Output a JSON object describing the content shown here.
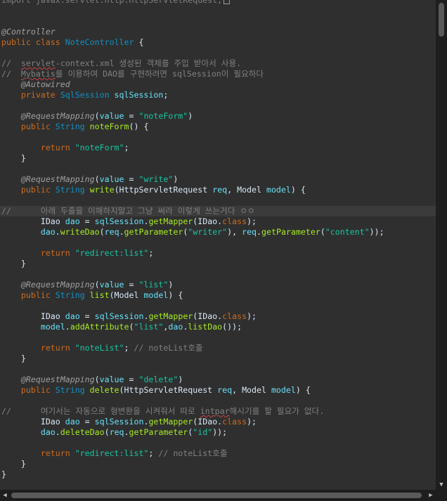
{
  "editor": {
    "lines": [
      [
        {
          "t": "import javax.servlet.http.HttpServletRequest;",
          "c": "cmt"
        },
        {
          "t": "",
          "c": "box"
        }
      ],
      [],
      [],
      [
        {
          "t": "@Controller",
          "c": "ann"
        }
      ],
      [
        {
          "t": "public ",
          "c": "kw"
        },
        {
          "t": "class ",
          "c": "kw"
        },
        {
          "t": "NoteController",
          "c": "typ"
        },
        {
          "t": " {",
          "c": ""
        }
      ],
      [],
      [
        {
          "t": "//  ",
          "c": "cmt"
        },
        {
          "t": "servlet",
          "c": "cmt squig"
        },
        {
          "t": "-context.xml 생성된 객체를 주입 받아서 사용.",
          "c": "cmt"
        }
      ],
      [
        {
          "t": "//  ",
          "c": "cmt"
        },
        {
          "t": "Mybatis",
          "c": "cmt squig"
        },
        {
          "t": "를 이용하여 DAO를 구현하려면 sqlSession이 필요하다",
          "c": "cmt"
        }
      ],
      [
        {
          "t": "    @Autowired",
          "c": "ann"
        }
      ],
      [
        {
          "t": "    private ",
          "c": "kw"
        },
        {
          "t": "SqlSession ",
          "c": "typ"
        },
        {
          "t": "sqlSession",
          "c": "var"
        },
        {
          "t": ";",
          "c": ""
        }
      ],
      [],
      [
        {
          "t": "    @RequestMapping",
          "c": "ann"
        },
        {
          "t": "(",
          "c": ""
        },
        {
          "t": "value",
          "c": "var"
        },
        {
          "t": " = ",
          "c": ""
        },
        {
          "t": "\"noteForm\"",
          "c": "str"
        },
        {
          "t": ")",
          "c": ""
        }
      ],
      [
        {
          "t": "    public ",
          "c": "kw"
        },
        {
          "t": "String ",
          "c": "typ"
        },
        {
          "t": "noteForm",
          "c": "mth"
        },
        {
          "t": "() {",
          "c": ""
        }
      ],
      [],
      [
        {
          "t": "        return ",
          "c": "kw"
        },
        {
          "t": "\"noteForm\"",
          "c": "str"
        },
        {
          "t": ";",
          "c": ""
        }
      ],
      [
        {
          "t": "    }",
          "c": ""
        }
      ],
      [],
      [
        {
          "t": "    @RequestMapping",
          "c": "ann"
        },
        {
          "t": "(",
          "c": ""
        },
        {
          "t": "value",
          "c": "var"
        },
        {
          "t": " = ",
          "c": ""
        },
        {
          "t": "\"write\"",
          "c": "str"
        },
        {
          "t": ")",
          "c": ""
        }
      ],
      [
        {
          "t": "    public ",
          "c": "kw"
        },
        {
          "t": "String ",
          "c": "typ"
        },
        {
          "t": "write",
          "c": "mth"
        },
        {
          "t": "(HttpServletRequest ",
          "c": ""
        },
        {
          "t": "req",
          "c": "var"
        },
        {
          "t": ", Model ",
          "c": ""
        },
        {
          "t": "model",
          "c": "var"
        },
        {
          "t": ") {",
          "c": ""
        }
      ],
      [],
      [
        {
          "t": "//      아래 두줄을 이해하지말고 그냥 써라 이렇게 쓰는거다 ㅇㅇ",
          "c": "cmt"
        }
      ],
      [
        {
          "t": "        IDao ",
          "c": ""
        },
        {
          "t": "dao",
          "c": "var"
        },
        {
          "t": " = ",
          "c": ""
        },
        {
          "t": "sqlSession",
          "c": "var"
        },
        {
          "t": ".",
          "c": ""
        },
        {
          "t": "getMapper",
          "c": "mth"
        },
        {
          "t": "(IDao.",
          "c": ""
        },
        {
          "t": "class",
          "c": "kw"
        },
        {
          "t": ");",
          "c": ""
        }
      ],
      [
        {
          "t": "        ",
          "c": ""
        },
        {
          "t": "dao",
          "c": "var"
        },
        {
          "t": ".",
          "c": ""
        },
        {
          "t": "writeDao",
          "c": "mth"
        },
        {
          "t": "(",
          "c": ""
        },
        {
          "t": "req",
          "c": "var"
        },
        {
          "t": ".",
          "c": ""
        },
        {
          "t": "getParameter",
          "c": "mth"
        },
        {
          "t": "(",
          "c": ""
        },
        {
          "t": "\"writer\"",
          "c": "str"
        },
        {
          "t": "), ",
          "c": ""
        },
        {
          "t": "req",
          "c": "var"
        },
        {
          "t": ".",
          "c": ""
        },
        {
          "t": "getParameter",
          "c": "mth"
        },
        {
          "t": "(",
          "c": ""
        },
        {
          "t": "\"content\"",
          "c": "str"
        },
        {
          "t": "));",
          "c": ""
        }
      ],
      [],
      [
        {
          "t": "        return ",
          "c": "kw"
        },
        {
          "t": "\"redirect:list\"",
          "c": "str"
        },
        {
          "t": ";",
          "c": ""
        }
      ],
      [
        {
          "t": "    }",
          "c": ""
        }
      ],
      [],
      [
        {
          "t": "    @RequestMapping",
          "c": "ann"
        },
        {
          "t": "(",
          "c": ""
        },
        {
          "t": "value",
          "c": "var"
        },
        {
          "t": " = ",
          "c": ""
        },
        {
          "t": "\"list\"",
          "c": "str"
        },
        {
          "t": ")",
          "c": ""
        }
      ],
      [
        {
          "t": "    public ",
          "c": "kw"
        },
        {
          "t": "String ",
          "c": "typ"
        },
        {
          "t": "list",
          "c": "mth"
        },
        {
          "t": "(Model ",
          "c": ""
        },
        {
          "t": "model",
          "c": "var"
        },
        {
          "t": ") {",
          "c": ""
        }
      ],
      [],
      [
        {
          "t": "        IDao ",
          "c": ""
        },
        {
          "t": "dao",
          "c": "var"
        },
        {
          "t": " = ",
          "c": ""
        },
        {
          "t": "sqlSession",
          "c": "var"
        },
        {
          "t": ".",
          "c": ""
        },
        {
          "t": "getMapper",
          "c": "mth"
        },
        {
          "t": "(IDao.",
          "c": ""
        },
        {
          "t": "class",
          "c": "kw"
        },
        {
          "t": ");",
          "c": ""
        }
      ],
      [
        {
          "t": "        ",
          "c": ""
        },
        {
          "t": "model",
          "c": "var"
        },
        {
          "t": ".",
          "c": ""
        },
        {
          "t": "addAttribute",
          "c": "mth"
        },
        {
          "t": "(",
          "c": ""
        },
        {
          "t": "\"list\"",
          "c": "str"
        },
        {
          "t": ",",
          "c": ""
        },
        {
          "t": "dao",
          "c": "var"
        },
        {
          "t": ".",
          "c": ""
        },
        {
          "t": "listDao",
          "c": "mth"
        },
        {
          "t": "());",
          "c": ""
        }
      ],
      [],
      [
        {
          "t": "        return ",
          "c": "kw"
        },
        {
          "t": "\"noteList\"",
          "c": "str"
        },
        {
          "t": "; ",
          "c": ""
        },
        {
          "t": "// noteList호출",
          "c": "cmt"
        }
      ],
      [
        {
          "t": "    }",
          "c": ""
        }
      ],
      [],
      [
        {
          "t": "    @RequestMapping",
          "c": "ann"
        },
        {
          "t": "(",
          "c": ""
        },
        {
          "t": "value",
          "c": "var"
        },
        {
          "t": " = ",
          "c": ""
        },
        {
          "t": "\"delete\"",
          "c": "str"
        },
        {
          "t": ")",
          "c": ""
        }
      ],
      [
        {
          "t": "    public ",
          "c": "kw"
        },
        {
          "t": "String ",
          "c": "typ"
        },
        {
          "t": "delete",
          "c": "mth"
        },
        {
          "t": "(HttpServletRequest ",
          "c": ""
        },
        {
          "t": "req",
          "c": "var"
        },
        {
          "t": ", Model ",
          "c": ""
        },
        {
          "t": "model",
          "c": "var"
        },
        {
          "t": ") {",
          "c": ""
        }
      ],
      [],
      [
        {
          "t": "//      여기서는 자동으로 형변환을 시켜줘서 따로 ",
          "c": "cmt"
        },
        {
          "t": "intpar",
          "c": "cmt squig"
        },
        {
          "t": "해시기를 할 필요가 없다.",
          "c": "cmt"
        }
      ],
      [
        {
          "t": "        IDao ",
          "c": ""
        },
        {
          "t": "dao",
          "c": "var"
        },
        {
          "t": " = ",
          "c": ""
        },
        {
          "t": "sqlSession",
          "c": "var"
        },
        {
          "t": ".",
          "c": ""
        },
        {
          "t": "getMapper",
          "c": "mth"
        },
        {
          "t": "(IDao.",
          "c": ""
        },
        {
          "t": "class",
          "c": "kw"
        },
        {
          "t": ");",
          "c": ""
        }
      ],
      [
        {
          "t": "        ",
          "c": ""
        },
        {
          "t": "dao",
          "c": "var"
        },
        {
          "t": ".",
          "c": ""
        },
        {
          "t": "deleteDao",
          "c": "mth"
        },
        {
          "t": "(",
          "c": ""
        },
        {
          "t": "req",
          "c": "var"
        },
        {
          "t": ".",
          "c": ""
        },
        {
          "t": "getParameter",
          "c": "mth"
        },
        {
          "t": "(",
          "c": ""
        },
        {
          "t": "\"id\"",
          "c": "str"
        },
        {
          "t": "));",
          "c": ""
        }
      ],
      [],
      [
        {
          "t": "        return ",
          "c": "kw"
        },
        {
          "t": "\"redirect:list\"",
          "c": "str"
        },
        {
          "t": "; ",
          "c": ""
        },
        {
          "t": "// noteList호출",
          "c": "cmt"
        }
      ],
      [
        {
          "t": "    }",
          "c": ""
        }
      ],
      [
        {
          "t": "}",
          "c": ""
        }
      ]
    ],
    "highlighted_line": 20
  },
  "scrollbars": {
    "up_arrow": "▲",
    "down_arrow": "▼",
    "left_arrow": "◀",
    "right_arrow": "▶"
  }
}
